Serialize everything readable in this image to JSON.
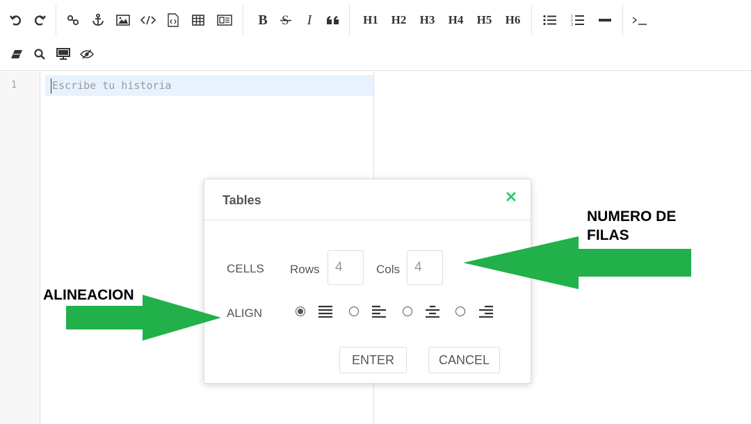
{
  "toolbar": {
    "row1": [
      "undo-icon",
      "redo-icon",
      "|",
      "link-icon",
      "anchor-icon",
      "image-icon",
      "code-icon",
      "code-block-icon",
      "table-icon",
      "html-entities-icon",
      "|",
      "B",
      "S",
      "I",
      "quote-icon",
      "|",
      "H1",
      "H2",
      "H3",
      "H4",
      "H5",
      "H6",
      "|",
      "unordered-list-icon",
      "ordered-list-icon",
      "horizontal-rule-icon",
      "|",
      "terminal-icon"
    ],
    "row2": [
      "eraser-icon",
      "search-icon",
      "monitor-icon",
      "eye-slash-icon"
    ],
    "labels": {
      "bold": "B",
      "italic": "I",
      "h1": "H1",
      "h2": "H2",
      "h3": "H3",
      "h4": "H4",
      "h5": "H5",
      "h6": "H6"
    }
  },
  "editor": {
    "line_number": "1",
    "placeholder": "Escribe tu historia"
  },
  "dialog": {
    "title": "Tables",
    "cells_label": "CELLS",
    "rows_label": "Rows",
    "rows_value": "4",
    "cols_label": "Cols",
    "cols_value": "4",
    "align_label": "ALIGN",
    "align_options": [
      "justify",
      "left",
      "center",
      "right"
    ],
    "align_selected": "justify",
    "enter_label": "ENTER",
    "cancel_label": "CANCEL"
  },
  "annotations": {
    "right_text": "NUMERO DE FILAS",
    "left_text": "ALINEACION",
    "arrow_color": "#22b04b"
  },
  "colors": {
    "close": "#2ecc71",
    "active_line": "#e8f2ff"
  }
}
